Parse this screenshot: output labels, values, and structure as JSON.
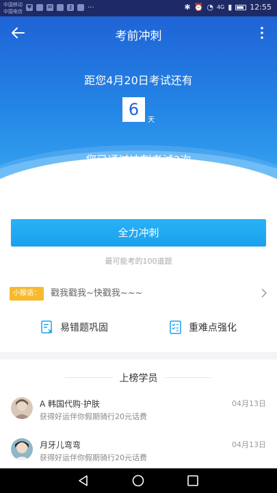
{
  "statusbar": {
    "carrier_1": "中国移动",
    "carrier_2": "中国电信",
    "time": "12:55",
    "network": "4G"
  },
  "header": {
    "title": "考前冲刺",
    "back_icon": "arrow-left-icon",
    "more_icon": "more-vertical-icon"
  },
  "countdown": {
    "text": "距您4月20日考试还有",
    "days": "6",
    "unit": "天",
    "passed_text": "您已通过冲刺考试3次"
  },
  "sprint": {
    "button_label": "全力冲刺",
    "subtitle": "最可能考的100道题"
  },
  "tip": {
    "badge": "小猴语：",
    "text": "戳我戳我~快戳我~~~"
  },
  "shortcuts": [
    {
      "label": "易错题巩固",
      "icon": "note-edit-icon"
    },
    {
      "label": "重难点强化",
      "icon": "checklist-icon"
    }
  ],
  "ranking": {
    "title": "上榜学员",
    "members": [
      {
        "name": "A 韩国代购·护肤",
        "message": "获得好运伴你假期骑行20元话费",
        "date": "04月13日"
      },
      {
        "name": "月牙儿弯弯",
        "message": "获得好运伴你假期骑行20元话费",
        "date": "04月13日"
      }
    ]
  },
  "colors": {
    "primary": "#1aa0ee",
    "hero_top": "#1f63d6",
    "badge": "#f7b92e",
    "statusbar": "#1e2a66"
  }
}
